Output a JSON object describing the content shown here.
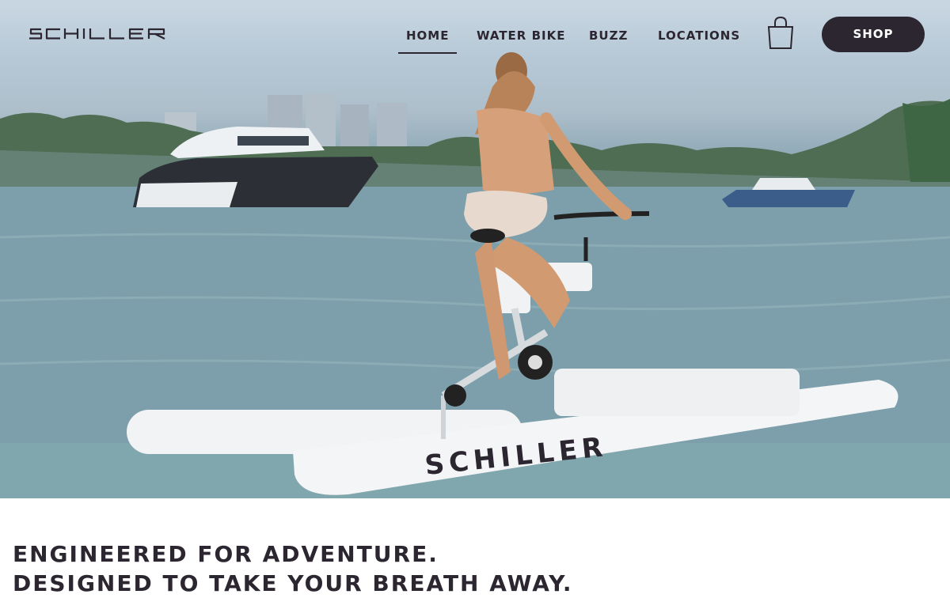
{
  "brand": {
    "name": "SCHILLER"
  },
  "nav": {
    "items": [
      {
        "label": "HOME",
        "active": true
      },
      {
        "label": "WATER BIKE",
        "active": false
      },
      {
        "label": "BUZZ",
        "active": false
      },
      {
        "label": "LOCATIONS",
        "active": false
      }
    ],
    "cart_icon": "shopping-bag-icon",
    "shop_label": "SHOP"
  },
  "hero": {
    "image_subject": "rider on a Schiller water bike near a yacht",
    "bike_brand_text": "SCHILLER"
  },
  "headline": {
    "line1": "ENGINEERED FOR ADVENTURE.",
    "line2": "DESIGNED TO TAKE YOUR BREATH AWAY."
  },
  "colors": {
    "accent": "#2b2630",
    "water": "#7ea2ae",
    "sky": "#c9d7e2"
  }
}
